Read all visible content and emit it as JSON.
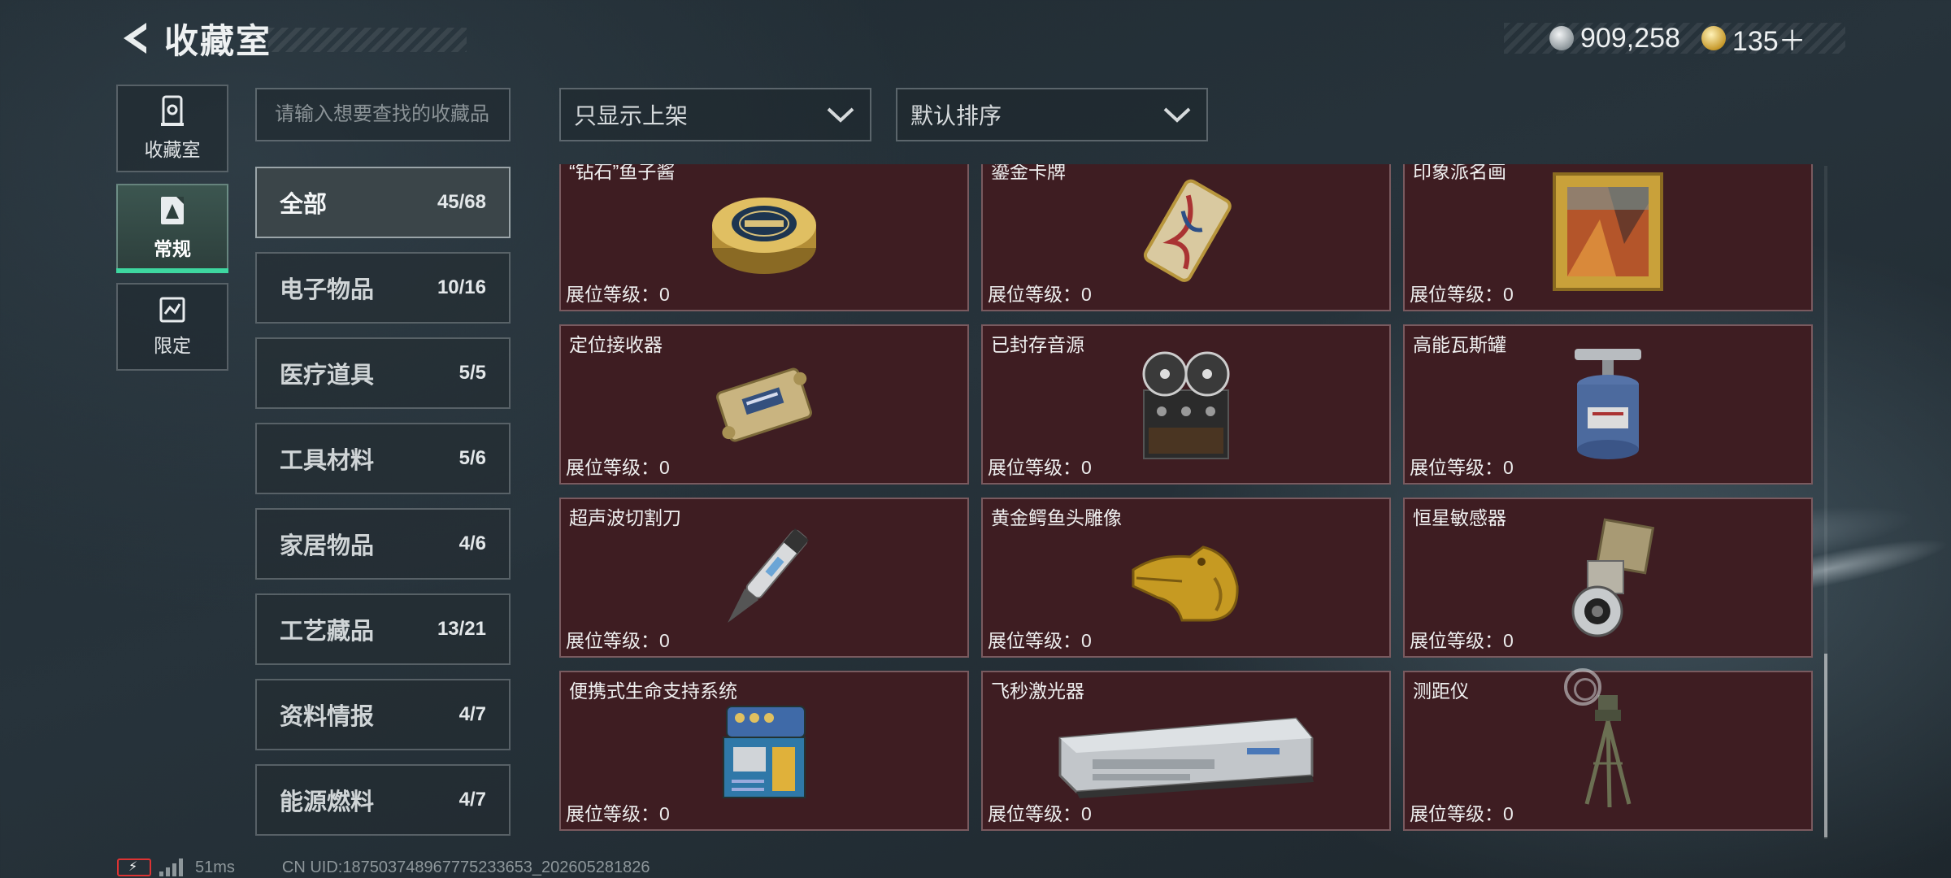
{
  "header": {
    "title": "收藏室"
  },
  "currency": [
    {
      "icon": "silver-coin-icon",
      "value": "909,258"
    },
    {
      "icon": "gold-coin-icon",
      "value": "135＋"
    }
  ],
  "categories": [
    {
      "label": "收藏室",
      "icon": "collection-room-icon",
      "active": false
    },
    {
      "label": "常规",
      "icon": "regular-icon",
      "active": true
    },
    {
      "label": "限定",
      "icon": "limited-icon",
      "active": false
    }
  ],
  "search": {
    "placeholder": "请输入想要查找的收藏品",
    "value": ""
  },
  "filters": {
    "shelf": "只显示上架",
    "sort": "默认排序"
  },
  "subcategories": [
    {
      "name": "全部",
      "count": "45/68",
      "active": true
    },
    {
      "name": "电子物品",
      "count": "10/16",
      "active": false
    },
    {
      "name": "医疗道具",
      "count": "5/5",
      "active": false
    },
    {
      "name": "工具材料",
      "count": "5/6",
      "active": false
    },
    {
      "name": "家居物品",
      "count": "4/6",
      "active": false
    },
    {
      "name": "工艺藏品",
      "count": "13/21",
      "active": false
    },
    {
      "name": "资料情报",
      "count": "4/7",
      "active": false
    },
    {
      "name": "能源燃料",
      "count": "4/7",
      "active": false
    }
  ],
  "items": [
    {
      "name": "“钻石”鱼子酱",
      "level": "展位等级：0",
      "art": "caviar-tin",
      "marked": true
    },
    {
      "name": "鎏金卡牌",
      "level": "展位等级：0",
      "art": "gilded-card",
      "marked": true
    },
    {
      "name": "印象派名画",
      "level": "展位等级：0",
      "art": "framed-painting",
      "marked": false
    },
    {
      "name": "定位接收器",
      "level": "展位等级：0",
      "art": "locator-receiver",
      "marked": false
    },
    {
      "name": "已封存音源",
      "level": "展位等级：0",
      "art": "reel-to-reel-recorder",
      "marked": false
    },
    {
      "name": "高能瓦斯罐",
      "level": "展位等级：0",
      "art": "gas-canister",
      "marked": false
    },
    {
      "name": "超声波切割刀",
      "level": "展位等级：0",
      "art": "ultrasonic-cutter",
      "marked": false
    },
    {
      "name": "黄金鳄鱼头雕像",
      "level": "展位等级：0",
      "art": "gold-crocodile-head",
      "marked": false
    },
    {
      "name": "恒星敏感器",
      "level": "展位等级：0",
      "art": "star-sensor",
      "marked": false
    },
    {
      "name": "便携式生命支持系统",
      "level": "展位等级：0",
      "art": "life-support-pack",
      "marked": false
    },
    {
      "name": "飞秒激光器",
      "level": "展位等级：0",
      "art": "femtosecond-laser",
      "marked": false
    },
    {
      "name": "测距仪",
      "level": "展位等级：0",
      "art": "rangefinder-tripod",
      "marked": false
    }
  ],
  "footer": {
    "ping": "51ms",
    "uid": "CN UID:187503748967775233653_202605281826"
  },
  "colors": {
    "accent": "#3ed7a0",
    "card_bg": "#3e1d22",
    "marker": "#e3b52f"
  }
}
